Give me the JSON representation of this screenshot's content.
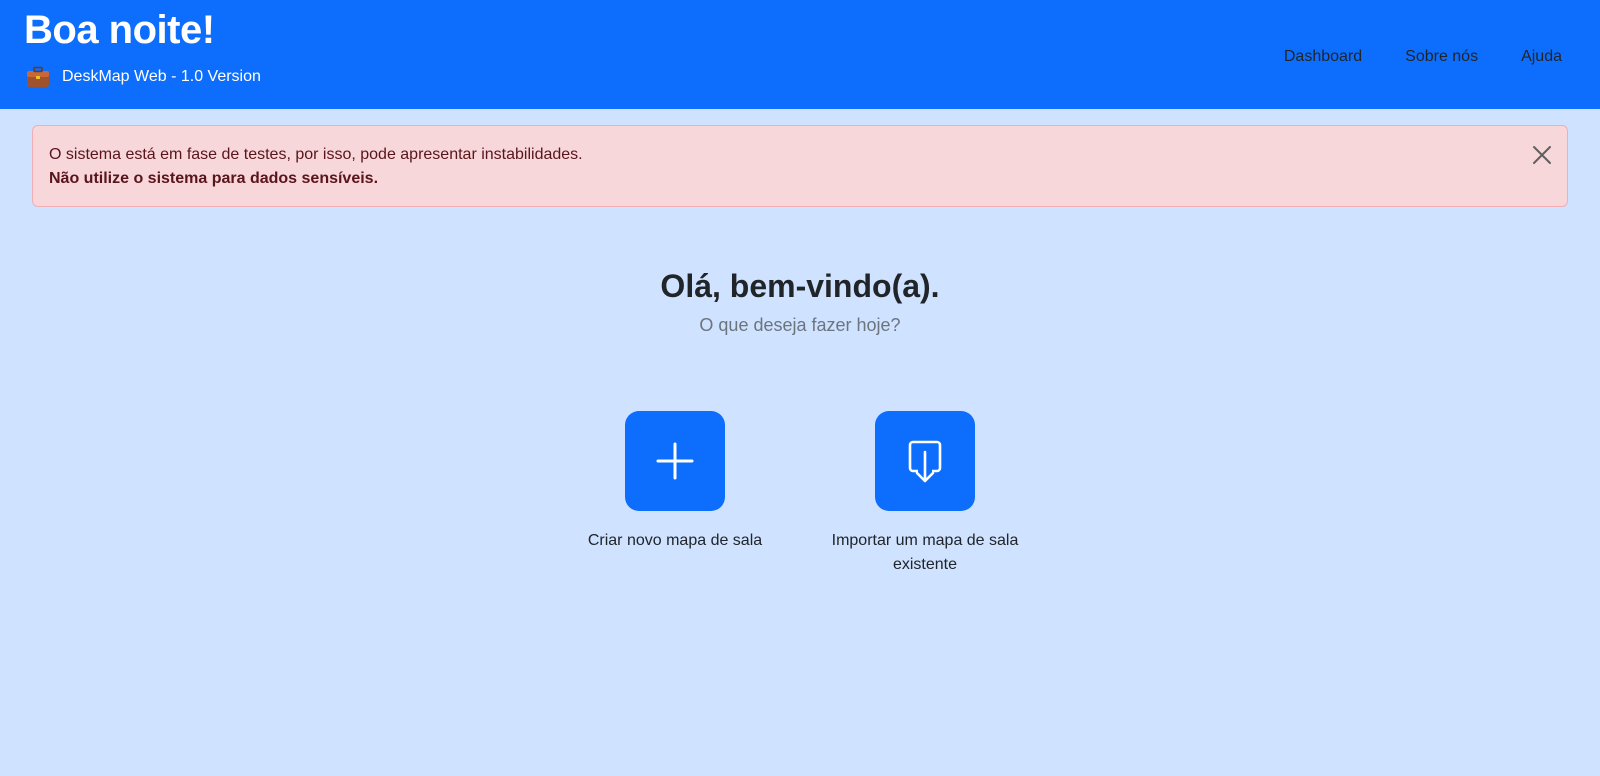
{
  "header": {
    "greeting": "Boa noite!",
    "app_name": "DeskMap Web - 1.0 Version",
    "app_icon": "briefcase-icon",
    "nav": [
      {
        "label": "Dashboard"
      },
      {
        "label": "Sobre nós"
      },
      {
        "label": "Ajuda"
      }
    ]
  },
  "alert": {
    "line1": "O sistema está em fase de testes, por isso, pode apresentar instabilidades.",
    "line2": "Não utilize o sistema para dados sensíveis.",
    "close_icon": "close-icon"
  },
  "welcome": {
    "title": "Olá, bem-vindo(a).",
    "subtitle": "O que deseja fazer hoje?"
  },
  "actions": [
    {
      "label": "Criar novo mapa de sala",
      "icon": "plus-icon"
    },
    {
      "label": "Importar um mapa de sala existente",
      "icon": "import-icon"
    }
  ],
  "colors": {
    "primary": "#0d6efd",
    "background": "#cfe2ff",
    "alert_bg": "#f8d7da",
    "alert_text": "#58151c"
  }
}
